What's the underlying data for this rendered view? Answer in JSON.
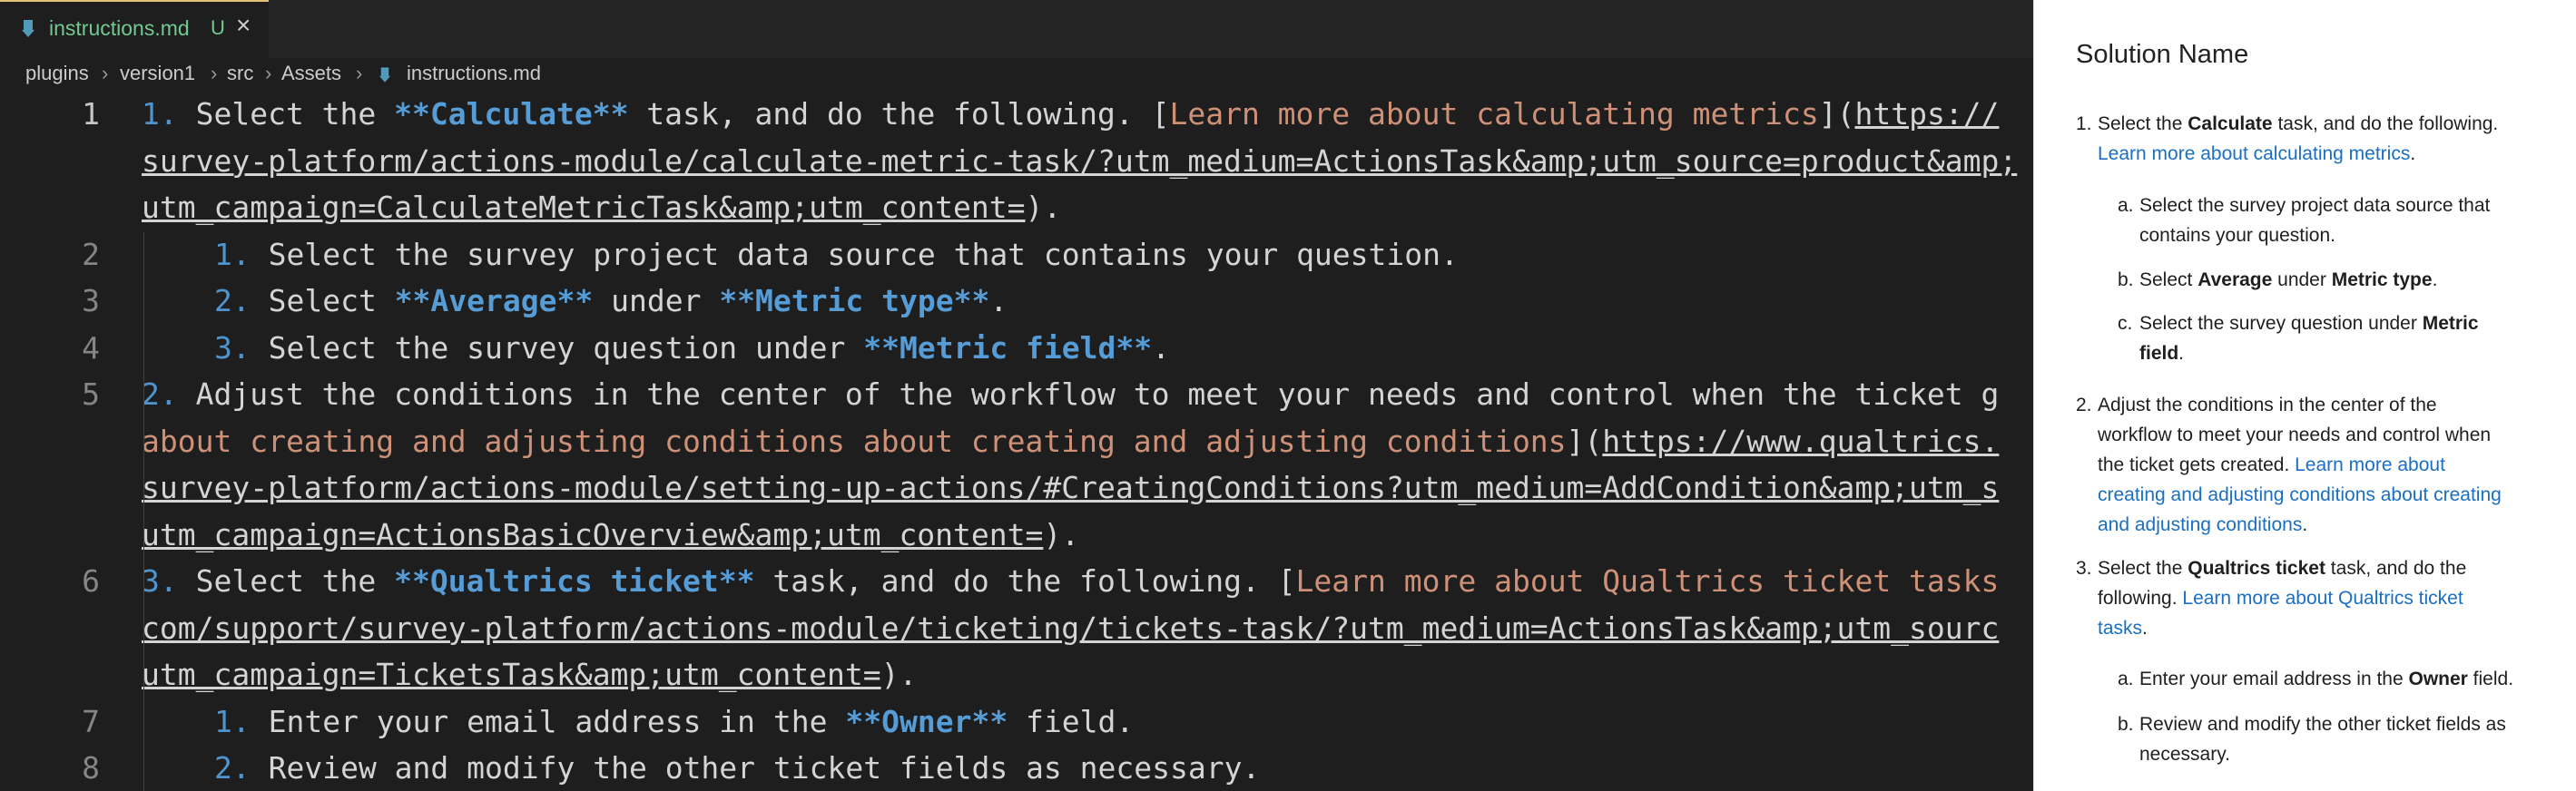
{
  "tab": {
    "filename": "instructions.md",
    "status": "U",
    "close": "×"
  },
  "breadcrumb": [
    "plugins",
    "version1",
    "src",
    "Assets",
    "instructions.md"
  ],
  "editor": {
    "lines": [
      {
        "n": "1",
        "parts": [
          [
            "num",
            "1. "
          ],
          [
            "p",
            "Select the "
          ],
          [
            "bold",
            "**Calculate**"
          ],
          [
            "p",
            " task, and do the following. ["
          ],
          [
            "link",
            "Learn more about calculating metrics"
          ],
          [
            "p",
            "]("
          ],
          [
            "url",
            "https://"
          ]
        ]
      },
      {
        "n": "",
        "parts": [
          [
            "url",
            "survey-platform/actions-module/calculate-metric-task/?utm_medium=ActionsTask&amp;utm_source=product&amp;"
          ]
        ]
      },
      {
        "n": "",
        "parts": [
          [
            "url",
            "utm_campaign=CalculateMetricTask&amp;utm_content="
          ],
          [
            "p",
            ")."
          ]
        ]
      },
      {
        "n": "2",
        "indent": true,
        "parts": [
          [
            "num",
            "1. "
          ],
          [
            "p",
            "Select the survey project data source that contains your question."
          ]
        ]
      },
      {
        "n": "3",
        "indent": true,
        "parts": [
          [
            "num",
            "2. "
          ],
          [
            "p",
            "Select "
          ],
          [
            "bold",
            "**Average**"
          ],
          [
            "p",
            " under "
          ],
          [
            "bold",
            "**Metric type**"
          ],
          [
            "p",
            "."
          ]
        ]
      },
      {
        "n": "4",
        "indent": true,
        "parts": [
          [
            "num",
            "3. "
          ],
          [
            "p",
            "Select the survey question under "
          ],
          [
            "bold",
            "**Metric field**"
          ],
          [
            "p",
            "."
          ]
        ]
      },
      {
        "n": "5",
        "parts": [
          [
            "num",
            "2. "
          ],
          [
            "p",
            "Adjust the conditions in the center of the workflow to meet your needs and control when the ticket g"
          ]
        ]
      },
      {
        "n": "",
        "parts": [
          [
            "link",
            "about creating and adjusting conditions about creating and adjusting conditions"
          ],
          [
            "p",
            "]("
          ],
          [
            "url",
            "https://www.qualtrics."
          ]
        ]
      },
      {
        "n": "",
        "parts": [
          [
            "url",
            "survey-platform/actions-module/setting-up-actions/#CreatingConditions?utm_medium=AddCondition&amp;utm_s"
          ]
        ]
      },
      {
        "n": "",
        "parts": [
          [
            "url",
            "utm_campaign=ActionsBasicOverview&amp;utm_content="
          ],
          [
            "p",
            ")."
          ]
        ]
      },
      {
        "n": "6",
        "parts": [
          [
            "num",
            "3. "
          ],
          [
            "p",
            "Select the "
          ],
          [
            "bold",
            "**Qualtrics ticket**"
          ],
          [
            "p",
            " task, and do the following. ["
          ],
          [
            "link",
            "Learn more about Qualtrics ticket tasks"
          ]
        ]
      },
      {
        "n": "",
        "parts": [
          [
            "url",
            "com/support/survey-platform/actions-module/ticketing/tickets-task/?utm_medium=ActionsTask&amp;utm_sourc"
          ]
        ]
      },
      {
        "n": "",
        "parts": [
          [
            "url",
            "utm_campaign=TicketsTask&amp;utm_content="
          ],
          [
            "p",
            ")."
          ]
        ]
      },
      {
        "n": "7",
        "indent": true,
        "parts": [
          [
            "num",
            "1. "
          ],
          [
            "p",
            "Enter your email address in the "
          ],
          [
            "bold",
            "**Owner**"
          ],
          [
            "p",
            " field."
          ]
        ]
      },
      {
        "n": "8",
        "indent": true,
        "parts": [
          [
            "num",
            "2. "
          ],
          [
            "p",
            "Review and modify the other ticket fields as necessary."
          ]
        ]
      }
    ]
  },
  "preview": {
    "title": "Solution Name",
    "items": [
      {
        "marker": "1.",
        "lines": [
          [
            [
              "t",
              "Select the "
            ],
            [
              "b",
              "Calculate"
            ],
            [
              "t",
              " task, and do the following."
            ]
          ],
          [
            [
              "l",
              "Learn more about calculating metrics"
            ],
            [
              "t",
              "."
            ]
          ]
        ]
      },
      {
        "marker": "a.",
        "lines": [
          [
            [
              "t",
              "Select the survey project data source that"
            ]
          ],
          [
            [
              "t",
              "contains your question."
            ]
          ]
        ]
      },
      {
        "marker": "b.",
        "lines": [
          [
            [
              "t",
              "Select "
            ],
            [
              "b",
              "Average"
            ],
            [
              "t",
              " under "
            ],
            [
              "b",
              "Metric type"
            ],
            [
              "t",
              "."
            ]
          ]
        ]
      },
      {
        "marker": "c.",
        "lines": [
          [
            [
              "t",
              "Select the survey question under "
            ],
            [
              "b",
              "Metric"
            ]
          ],
          [
            [
              "b",
              "field"
            ],
            [
              "t",
              "."
            ]
          ]
        ]
      },
      {
        "marker": "2.",
        "lines": [
          [
            [
              "t",
              "Adjust the conditions in the center of the"
            ]
          ],
          [
            [
              "t",
              "workflow to meet your needs and control when"
            ]
          ],
          [
            [
              "t",
              "the ticket gets created. "
            ],
            [
              "l",
              "Learn more about"
            ]
          ],
          [
            [
              "l",
              "creating and adjusting conditions about creating"
            ]
          ],
          [
            [
              "l",
              "and adjusting conditions"
            ],
            [
              "t",
              "."
            ]
          ]
        ]
      },
      {
        "marker": "3.",
        "lines": [
          [
            [
              "t",
              "Select the "
            ],
            [
              "b",
              "Qualtrics ticket"
            ],
            [
              "t",
              " task, and do the"
            ]
          ],
          [
            [
              "t",
              "following. "
            ],
            [
              "l",
              "Learn more about Qualtrics ticket"
            ]
          ],
          [
            [
              "l",
              "tasks"
            ],
            [
              "t",
              "."
            ]
          ]
        ]
      },
      {
        "marker": "a.",
        "lines": [
          [
            [
              "t",
              "Enter your email address in the "
            ],
            [
              "b",
              "Owner"
            ],
            [
              "t",
              " field."
            ]
          ]
        ]
      },
      {
        "marker": "b.",
        "lines": [
          [
            [
              "t",
              "Review and modify the other ticket fields as"
            ]
          ],
          [
            [
              "t",
              "necessary."
            ]
          ]
        ]
      }
    ]
  }
}
